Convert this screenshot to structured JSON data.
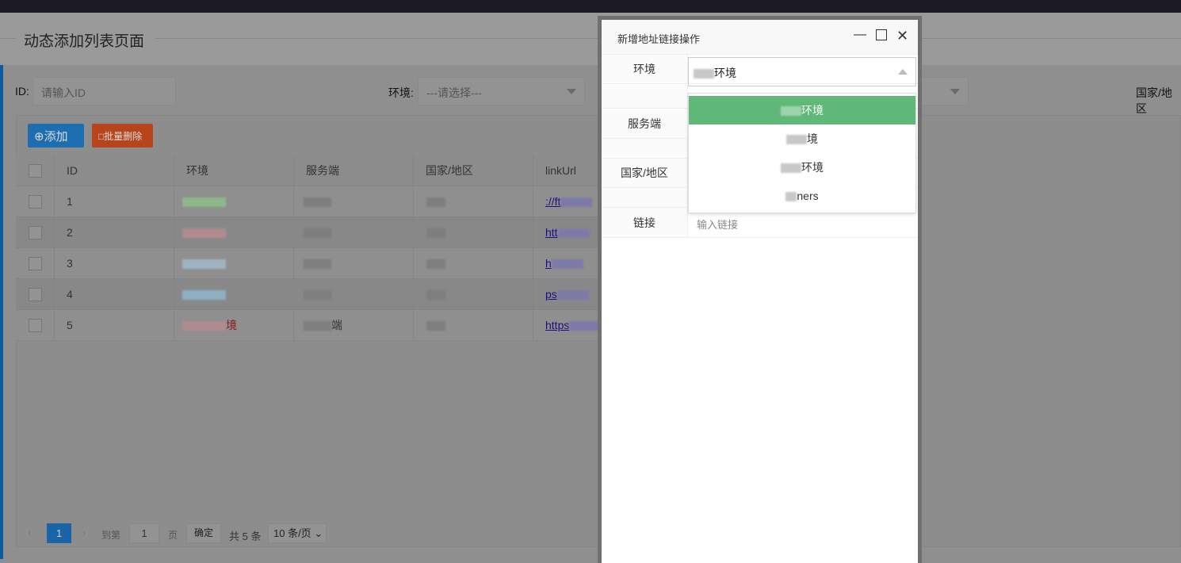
{
  "page": {
    "title": "动态添加列表页面"
  },
  "filters": {
    "id_label": "ID:",
    "id_placeholder": "请输入ID",
    "env_label": "环境:",
    "env_placeholder": "---请选择---",
    "country_label": "国家/地区"
  },
  "toolbar": {
    "add_label": "⊕添加",
    "batch_delete_label": "□批量删除"
  },
  "table": {
    "headers": [
      "ID",
      "环境",
      "服务端",
      "国家/地区",
      "linkUrl"
    ],
    "rows": [
      {
        "id": "1",
        "env": "",
        "server": "",
        "country": "",
        "link": "://ft"
      },
      {
        "id": "2",
        "env": "",
        "server": "",
        "country": "",
        "link": "htt"
      },
      {
        "id": "3",
        "env": "",
        "server": "",
        "country": "",
        "link": "h"
      },
      {
        "id": "4",
        "env": "",
        "server": "",
        "country": "",
        "link": "ps"
      },
      {
        "id": "5",
        "env": "境",
        "server": "端",
        "country": "",
        "link": "https"
      }
    ]
  },
  "pagination": {
    "current": "1",
    "goto_label": "到第",
    "goto_value": "1",
    "page_unit": "页",
    "confirm": "确定",
    "total": "共 5 条",
    "page_size": "10 条/页"
  },
  "modal": {
    "title": "新增地址链接操作",
    "fields": {
      "env_label": "环境",
      "env_value": "环境",
      "server_label": "服务端",
      "country_label": "国家/地区",
      "link_label": "链接",
      "link_placeholder": "输入链接"
    },
    "dropdown_options": [
      "环境",
      "境",
      "环境",
      "ners"
    ],
    "selected_color": "#5fb878"
  },
  "colors": {
    "add": "#1e7ac8",
    "delete": "#d9481c",
    "accent_bar": "#0e5aa0"
  }
}
